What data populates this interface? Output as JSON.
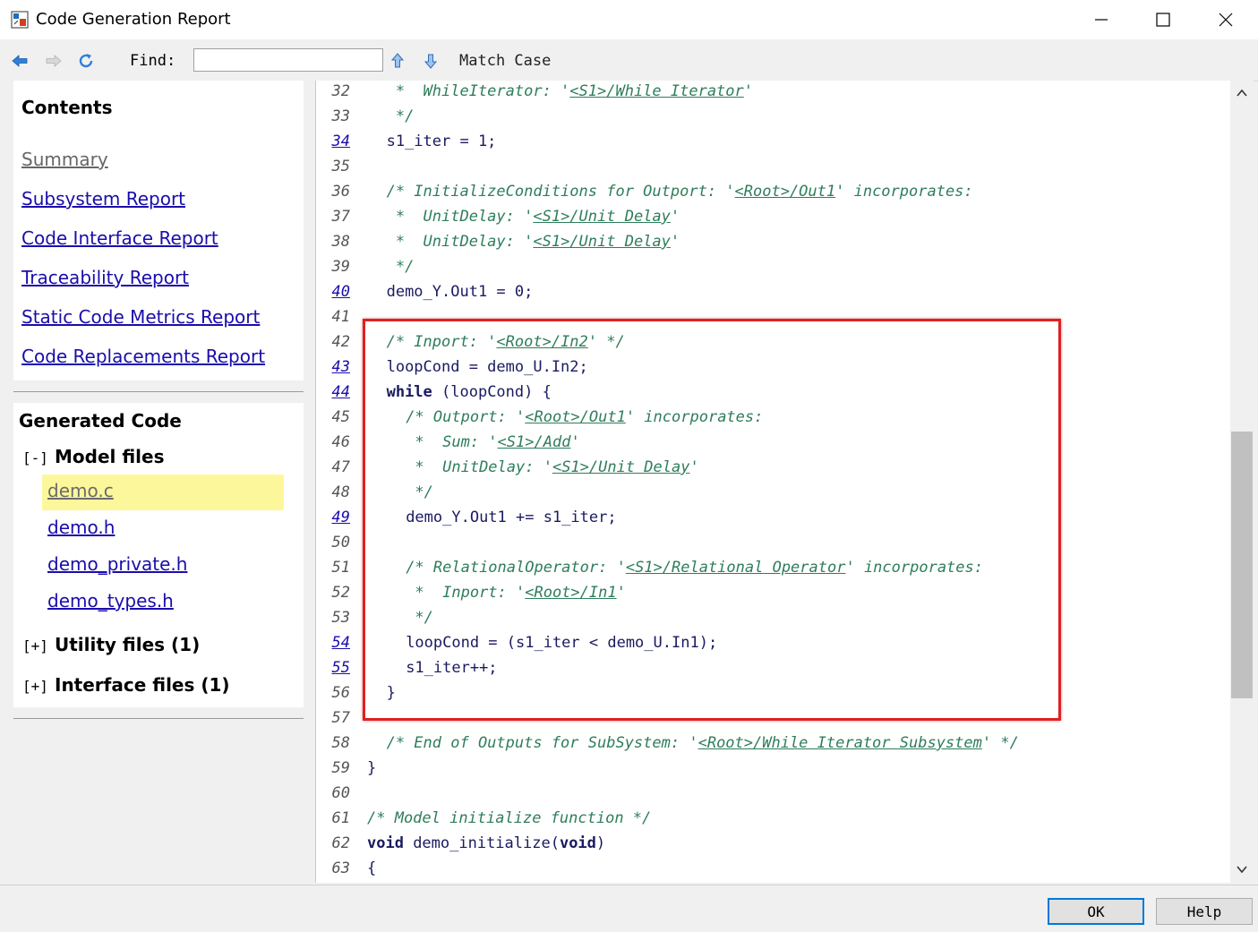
{
  "window": {
    "title": "Code Generation Report"
  },
  "toolbar": {
    "find_label": "Find:",
    "find_value": "",
    "match_case": "Match Case"
  },
  "contents": {
    "title": "Contents",
    "links": [
      "Summary",
      "Subsystem Report",
      "Code Interface Report",
      "Traceability Report",
      "Static Code Metrics Report",
      "Code Replacements Report"
    ]
  },
  "generated": {
    "title": "Generated Code",
    "model_toggle": "[-]",
    "model_label": "Model files",
    "model_files": [
      "demo.c",
      "demo.h",
      "demo_private.h",
      "demo_types.h"
    ],
    "utility_toggle": "[+]",
    "utility_label": "Utility files (1)",
    "interface_toggle": "[+]",
    "interface_label": "Interface files (1)"
  },
  "code_lines": [
    {
      "n": "32",
      "link": false,
      "indent": 1,
      "parts": [
        {
          "t": "c",
          "v": " *  WhileIterator: '"
        },
        {
          "t": "l",
          "v": "<S1>/While Iterator"
        },
        {
          "t": "c",
          "v": "'"
        }
      ]
    },
    {
      "n": "33",
      "link": false,
      "indent": 1,
      "parts": [
        {
          "t": "c",
          "v": " */"
        }
      ]
    },
    {
      "n": "34",
      "link": true,
      "indent": 1,
      "parts": [
        {
          "t": "p",
          "v": "s1_iter = 1;"
        }
      ]
    },
    {
      "n": "35",
      "link": false,
      "indent": 0,
      "parts": []
    },
    {
      "n": "36",
      "link": false,
      "indent": 1,
      "parts": [
        {
          "t": "c",
          "v": "/* InitializeConditions for Outport: '"
        },
        {
          "t": "l",
          "v": "<Root>/Out1"
        },
        {
          "t": "c",
          "v": "' incorporates:"
        }
      ]
    },
    {
      "n": "37",
      "link": false,
      "indent": 1,
      "parts": [
        {
          "t": "c",
          "v": " *  UnitDelay: '"
        },
        {
          "t": "l",
          "v": "<S1>/Unit Delay"
        },
        {
          "t": "c",
          "v": "'"
        }
      ]
    },
    {
      "n": "38",
      "link": false,
      "indent": 1,
      "parts": [
        {
          "t": "c",
          "v": " *  UnitDelay: '"
        },
        {
          "t": "l",
          "v": "<S1>/Unit Delay"
        },
        {
          "t": "c",
          "v": "'"
        }
      ]
    },
    {
      "n": "39",
      "link": false,
      "indent": 1,
      "parts": [
        {
          "t": "c",
          "v": " */"
        }
      ]
    },
    {
      "n": "40",
      "link": true,
      "indent": 1,
      "parts": [
        {
          "t": "p",
          "v": "demo_Y.Out1 = 0;"
        }
      ]
    },
    {
      "n": "41",
      "link": false,
      "indent": 0,
      "parts": []
    },
    {
      "n": "42",
      "link": false,
      "indent": 1,
      "parts": [
        {
          "t": "c",
          "v": "/* Inport: '"
        },
        {
          "t": "l",
          "v": "<Root>/In2"
        },
        {
          "t": "c",
          "v": "' */"
        }
      ]
    },
    {
      "n": "43",
      "link": true,
      "indent": 1,
      "parts": [
        {
          "t": "p",
          "v": "loopCond = demo_U.In2;"
        }
      ]
    },
    {
      "n": "44",
      "link": true,
      "indent": 1,
      "parts": [
        {
          "t": "k",
          "v": "while"
        },
        {
          "t": "p",
          "v": " (loopCond) {"
        }
      ]
    },
    {
      "n": "45",
      "link": false,
      "indent": 2,
      "parts": [
        {
          "t": "c",
          "v": "/* Outport: '"
        },
        {
          "t": "l",
          "v": "<Root>/Out1"
        },
        {
          "t": "c",
          "v": "' incorporates:"
        }
      ]
    },
    {
      "n": "46",
      "link": false,
      "indent": 2,
      "parts": [
        {
          "t": "c",
          "v": " *  Sum: '"
        },
        {
          "t": "l",
          "v": "<S1>/Add"
        },
        {
          "t": "c",
          "v": "'"
        }
      ]
    },
    {
      "n": "47",
      "link": false,
      "indent": 2,
      "parts": [
        {
          "t": "c",
          "v": " *  UnitDelay: '"
        },
        {
          "t": "l",
          "v": "<S1>/Unit Delay"
        },
        {
          "t": "c",
          "v": "'"
        }
      ]
    },
    {
      "n": "48",
      "link": false,
      "indent": 2,
      "parts": [
        {
          "t": "c",
          "v": " */"
        }
      ]
    },
    {
      "n": "49",
      "link": true,
      "indent": 2,
      "parts": [
        {
          "t": "p",
          "v": "demo_Y.Out1 += s1_iter;"
        }
      ]
    },
    {
      "n": "50",
      "link": false,
      "indent": 0,
      "parts": []
    },
    {
      "n": "51",
      "link": false,
      "indent": 2,
      "parts": [
        {
          "t": "c",
          "v": "/* RelationalOperator: '"
        },
        {
          "t": "l",
          "v": "<S1>/Relational Operator"
        },
        {
          "t": "c",
          "v": "' incorporates:"
        }
      ]
    },
    {
      "n": "52",
      "link": false,
      "indent": 2,
      "parts": [
        {
          "t": "c",
          "v": " *  Inport: '"
        },
        {
          "t": "l",
          "v": "<Root>/In1"
        },
        {
          "t": "c",
          "v": "'"
        }
      ]
    },
    {
      "n": "53",
      "link": false,
      "indent": 2,
      "parts": [
        {
          "t": "c",
          "v": " */"
        }
      ]
    },
    {
      "n": "54",
      "link": true,
      "indent": 2,
      "parts": [
        {
          "t": "p",
          "v": "loopCond = (s1_iter < demo_U.In1);"
        }
      ]
    },
    {
      "n": "55",
      "link": true,
      "indent": 2,
      "parts": [
        {
          "t": "p",
          "v": "s1_iter++;"
        }
      ]
    },
    {
      "n": "56",
      "link": false,
      "indent": 1,
      "parts": [
        {
          "t": "p",
          "v": "}"
        }
      ]
    },
    {
      "n": "57",
      "link": false,
      "indent": 0,
      "parts": []
    },
    {
      "n": "58",
      "link": false,
      "indent": 1,
      "parts": [
        {
          "t": "c",
          "v": "/* End of Outputs for SubSystem: '"
        },
        {
          "t": "l",
          "v": "<Root>/While Iterator Subsystem"
        },
        {
          "t": "c",
          "v": "' */"
        }
      ]
    },
    {
      "n": "59",
      "link": false,
      "indent": 0,
      "parts": [
        {
          "t": "p",
          "v": "}"
        }
      ]
    },
    {
      "n": "60",
      "link": false,
      "indent": 0,
      "parts": []
    },
    {
      "n": "61",
      "link": false,
      "indent": 0,
      "parts": [
        {
          "t": "c",
          "v": "/* Model initialize function */"
        }
      ]
    },
    {
      "n": "62",
      "link": false,
      "indent": 0,
      "parts": [
        {
          "t": "k",
          "v": "void"
        },
        {
          "t": "p",
          "v": " demo_initialize("
        },
        {
          "t": "k",
          "v": "void"
        },
        {
          "t": "p",
          "v": ")"
        }
      ]
    },
    {
      "n": "63",
      "link": false,
      "indent": 0,
      "parts": [
        {
          "t": "p",
          "v": "{"
        }
      ]
    }
  ],
  "buttons": {
    "ok": "OK",
    "help": "Help"
  },
  "colors": {
    "link": "#1a0dab",
    "comment": "#2e7d5b",
    "highlight_box": "#e02020",
    "selected_file": "#fdf79c"
  }
}
